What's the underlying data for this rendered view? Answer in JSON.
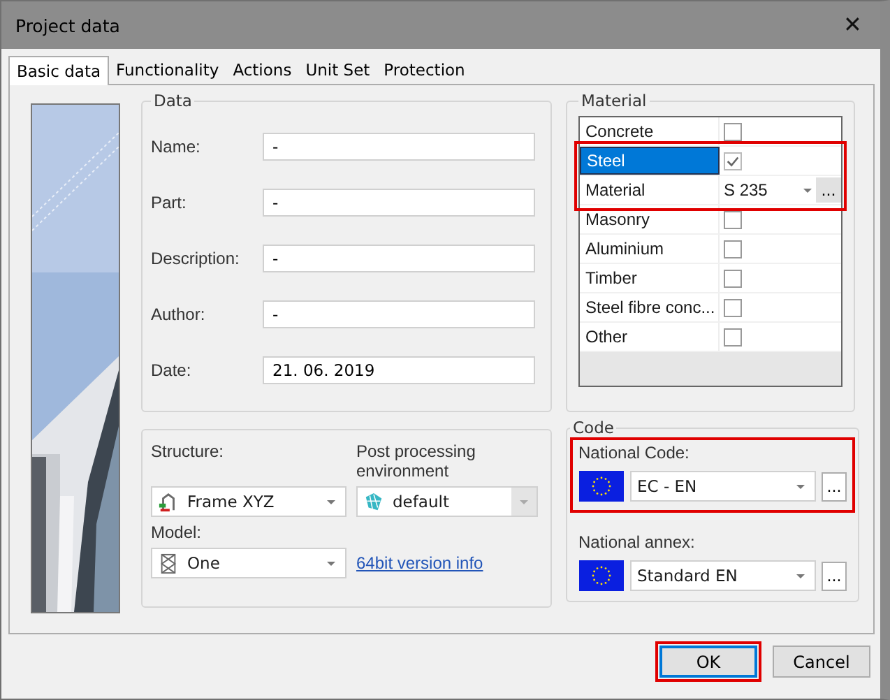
{
  "window": {
    "title": "Project data",
    "close": "✕"
  },
  "tabs": [
    {
      "label": "Basic data",
      "selected": true
    },
    {
      "label": "Functionality",
      "selected": false
    },
    {
      "label": "Actions",
      "selected": false
    },
    {
      "label": "Unit Set",
      "selected": false
    },
    {
      "label": "Protection",
      "selected": false
    }
  ],
  "data_group": {
    "title": "Data",
    "fields": [
      {
        "label": "Name:",
        "value": "-"
      },
      {
        "label": "Part:",
        "value": "-"
      },
      {
        "label": "Description:",
        "value": "-"
      },
      {
        "label": "Author:",
        "value": "-"
      },
      {
        "label": "Date:",
        "value": "21. 06. 2019"
      }
    ]
  },
  "structure": {
    "label": "Structure:",
    "value": "Frame XYZ"
  },
  "post_processing": {
    "label": "Post processing environment",
    "value": "default",
    "disabled": true
  },
  "model": {
    "label": "Model:",
    "value": "One"
  },
  "version_link": "64bit version info",
  "material_group": {
    "title": "Material",
    "rows": [
      {
        "label": "Concrete",
        "checked": false,
        "selected": false,
        "highlighted": false
      },
      {
        "label": "Steel",
        "checked": true,
        "selected": true,
        "highlighted": true,
        "children": [
          {
            "label": "Material",
            "value": "S 235",
            "button": "..."
          }
        ]
      },
      {
        "label": "Masonry",
        "checked": false,
        "selected": false,
        "highlighted": false
      },
      {
        "label": "Aluminium",
        "checked": false,
        "selected": false,
        "highlighted": false
      },
      {
        "label": "Timber",
        "checked": false,
        "selected": false,
        "highlighted": false
      },
      {
        "label": "Steel fibre conc...",
        "checked": false,
        "selected": false,
        "highlighted": false
      },
      {
        "label": "Other",
        "checked": false,
        "selected": false,
        "highlighted": false
      }
    ]
  },
  "code_group": {
    "title": "Code",
    "items": [
      {
        "label": "National Code:",
        "value": "EC - EN",
        "button": "...",
        "highlighted": true
      },
      {
        "label": "National annex:",
        "value": "Standard EN",
        "button": "...",
        "highlighted": false
      }
    ]
  },
  "buttons": [
    {
      "label": "OK",
      "default": true,
      "highlighted": true
    },
    {
      "label": "Cancel",
      "default": false,
      "highlighted": false
    }
  ]
}
